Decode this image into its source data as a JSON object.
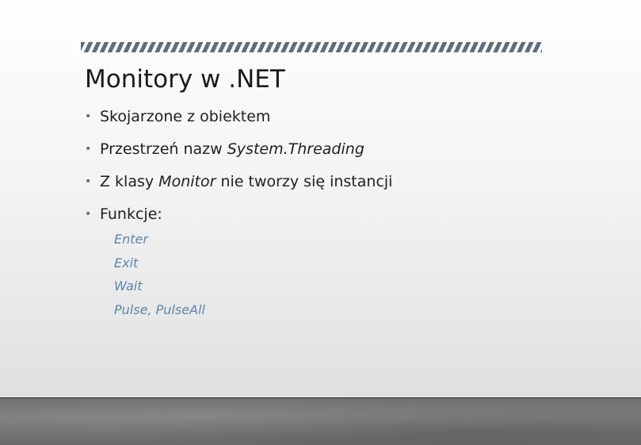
{
  "slide": {
    "title": "Monitory w .NET",
    "bullets": [
      {
        "text": "Skojarzone z obiektem"
      },
      {
        "prefix": "Przestrzeń nazw ",
        "italic": "System.Threading"
      },
      {
        "prefix": "Z klasy ",
        "italic": "Monitor",
        "suffix": " nie tworzy się instancji"
      },
      {
        "text": "Funkcje:"
      }
    ],
    "sub_items": [
      "Enter",
      "Exit",
      "Wait",
      "Pulse, PulseAll"
    ],
    "bullet_glyph": "•",
    "colors": {
      "accent_stripe": "#5f6b80",
      "sub_item_text": "#5a86ad",
      "body_text": "#1f1f1f"
    }
  }
}
